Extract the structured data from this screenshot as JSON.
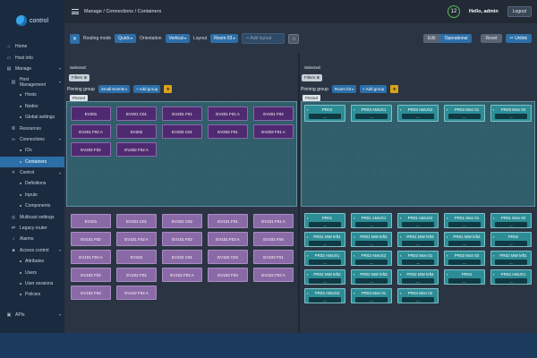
{
  "app": {
    "logo_text": "control"
  },
  "sidebar": {
    "items": [
      {
        "label": "Home",
        "icon": "home-icon"
      },
      {
        "label": "Host info",
        "icon": "monitor-icon"
      },
      {
        "label": "Manage",
        "icon": "folder-icon"
      },
      {
        "label": "Host Management",
        "icon": "server-icon"
      },
      {
        "label": "Hosts"
      },
      {
        "label": "Nodes"
      },
      {
        "label": "Global settings"
      },
      {
        "label": "Resources",
        "icon": "layers-icon"
      },
      {
        "label": "Connections",
        "icon": "link-icon"
      },
      {
        "label": "IOs"
      },
      {
        "label": "Containers"
      },
      {
        "label": "Control",
        "icon": "tools-icon"
      },
      {
        "label": "Definitions"
      },
      {
        "label": "Inputs"
      },
      {
        "label": "Components"
      },
      {
        "label": "Multicast settings",
        "icon": "broadcast-icon"
      },
      {
        "label": "Legacy router",
        "icon": "router-icon"
      },
      {
        "label": "Alarms",
        "icon": "bell-icon"
      },
      {
        "label": "Access control",
        "icon": "lock-icon"
      },
      {
        "label": "Attributes"
      },
      {
        "label": "Users"
      },
      {
        "label": "User sessions"
      },
      {
        "label": "Policies"
      }
    ],
    "bottom": {
      "label": "APIs",
      "icon": "api-icon"
    }
  },
  "header": {
    "breadcrumb": "Manage / Connections / Containers",
    "notification_count": "12",
    "greeting": "Hello, admin",
    "logout": "Logout"
  },
  "toolbar": {
    "routing_mode_label": "Routing mode",
    "routing_mode_value": "Quick",
    "orientation_label": "Orientation",
    "orientation_value": "Vertical",
    "layout_label": "Layout",
    "layout_value": "Room 03",
    "add_layout_placeholder": "+ Add layout",
    "edit_label": "Edit",
    "operational_label": "Operational",
    "reset_label": "Reset",
    "unlink_label": "Unlink"
  },
  "left_pane": {
    "selected_label": "Selected:",
    "filters_label": "Filters",
    "pinning_label": "Pinning group",
    "pinning_value": "Small Events",
    "add_group_label": "+ Add group",
    "pinned_tag": "Pinned",
    "pinned_cards": [
      "EV201",
      "EV201 C01",
      "EV201 F01",
      "EV201 F01 A",
      "EV201 F02",
      "EV201 F02 A",
      "EV202",
      "EV202 C01",
      "EV202 F01",
      "EV202 F01 A",
      "EV202 F02",
      "EV202 F02 A"
    ],
    "pool_cards": [
      "EV101",
      "EV101 C01",
      "EV101 C02",
      "EV101 F01",
      "EV101 F01 A",
      "EV101 F02",
      "EV101 F02 A",
      "EV101 F03",
      "EV101 F03 A",
      "EV101 F04",
      "EV101 F04 A",
      "EV102",
      "EV102 C01",
      "EV102 C02",
      "EV102 F01",
      "EV102 F02",
      "EV102 F02",
      "EV102 F02 A",
      "EV102 F03",
      "EV102 F03 A",
      "EV102 F04",
      "EV102 F04 A"
    ]
  },
  "right_pane": {
    "selected_label": "Selected:",
    "filters_label": "Filters",
    "pinning_label": "Pinning group",
    "pinning_value": "Room 03",
    "add_group_label": "+ Add group",
    "pinned_tag": "Pinned",
    "bar_text": "—",
    "pinned_cards": [
      "PR03",
      "PR03 AMUX1",
      "PR03 AMUX2",
      "PR03 Mon 01",
      "PR03 Mon 02"
    ],
    "pool_cards": [
      "PR01",
      "PR01 AMUX1",
      "PR01 AMUX2",
      "PR01 Mon 01",
      "PR01 Mon 02",
      "PR01 MW left1",
      "PR01 MW left2",
      "PR01 MW left3",
      "PR01 MW left4",
      "PR02",
      "PR02 AMUX1",
      "PR02 AMUX2",
      "PR02 Mon 01",
      "PR02 Mon 02",
      "PR02 MW left1",
      "PR02 MW left2",
      "PR02 MW left3",
      "PR02 MW left4",
      "PR04",
      "PR04 AMUX1",
      "PR04 AMUX2",
      "PR04 Mon 01",
      "PR04 Mon 02"
    ]
  }
}
